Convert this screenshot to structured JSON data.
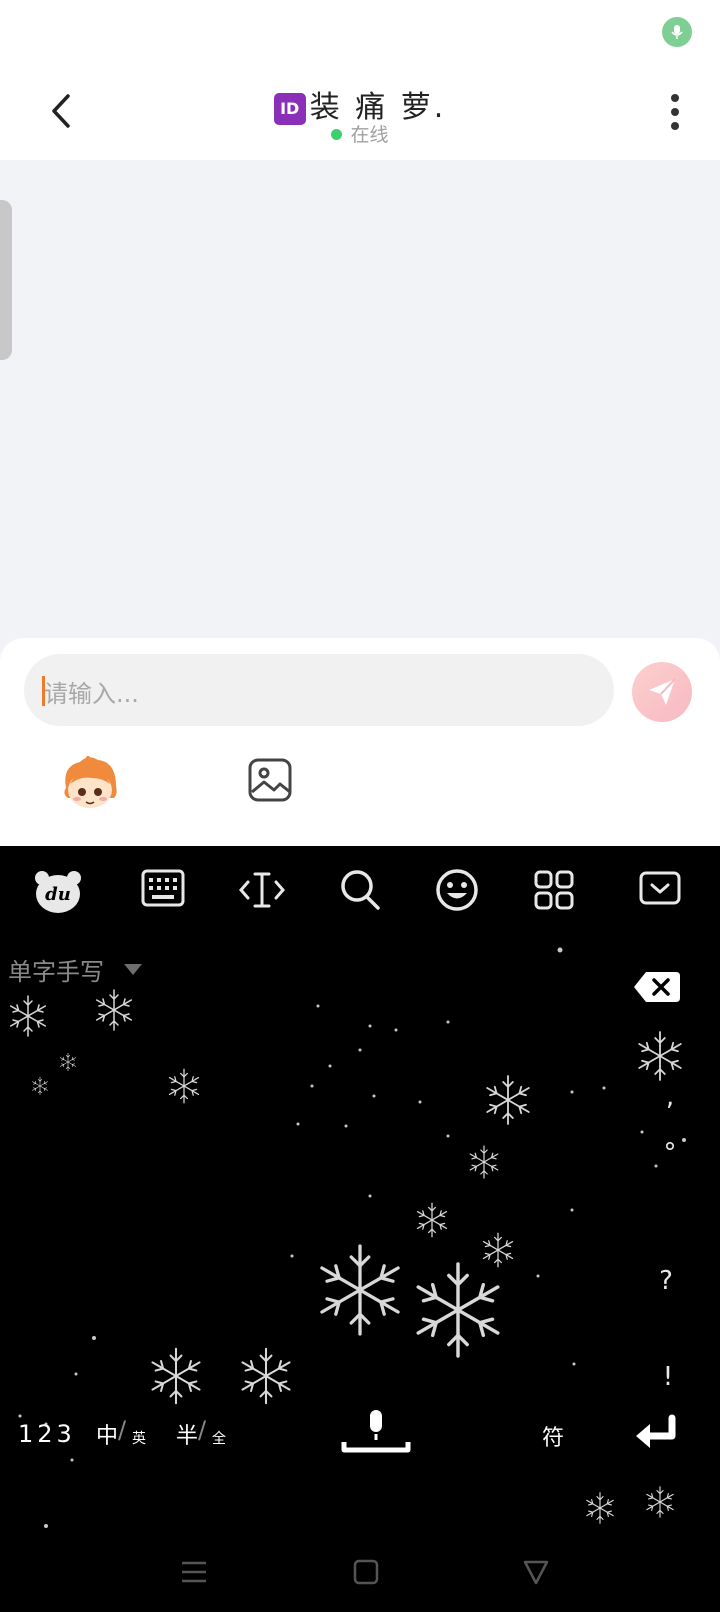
{
  "header": {
    "id_badge": "ID",
    "contact_name": "装 痛 萝.",
    "status": "在线"
  },
  "input": {
    "placeholder": "请输入..."
  },
  "keyboard": {
    "mode_label": "单字手写",
    "punctuation": [
      ",",
      "°",
      "?",
      "!"
    ],
    "bottom": {
      "numbers": "123",
      "zh": "中",
      "en": "英",
      "half": "半",
      "full": "全",
      "symbols": "符"
    }
  },
  "colors": {
    "online": "#3bd16f",
    "caret": "#ef7a2a",
    "id_badge": "#8a2fb8"
  },
  "icons": [
    "mic-icon",
    "back-arrow-icon",
    "more-vertical-icon",
    "send-icon",
    "sticker-icon",
    "image-icon",
    "du-logo-icon",
    "keyboard-icon",
    "cursor-move-icon",
    "search-icon",
    "emoji-icon",
    "apps-grid-icon",
    "collapse-keyboard-icon",
    "backspace-icon",
    "voice-input-icon",
    "enter-icon",
    "nav-menu-icon",
    "nav-home-icon",
    "nav-back-icon"
  ]
}
